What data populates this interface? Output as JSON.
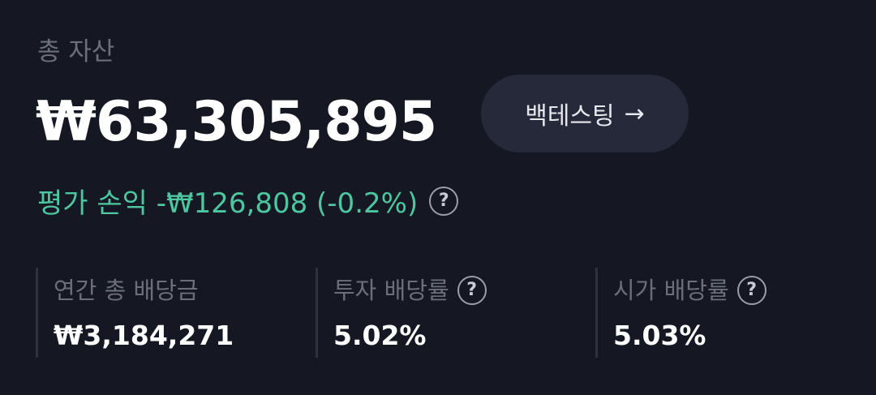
{
  "summary": {
    "total_label": "총 자산",
    "total_value": "₩63,305,895",
    "backtest_label": "백테스팅",
    "backtest_arrow": "→",
    "pnl_text": "평가 손익 -₩126,808 (-0.2%)",
    "help_glyph": "?"
  },
  "stats": [
    {
      "label": "연간 총 배당금",
      "value": "₩3,184,271",
      "has_help": false
    },
    {
      "label": "투자 배당률",
      "value": "5.02%",
      "has_help": true
    },
    {
      "label": "시가 배당률",
      "value": "5.03%",
      "has_help": true
    }
  ],
  "colors": {
    "background": "#151823",
    "button_bg": "#252939",
    "pnl_green": "#4dc7a0",
    "muted_text": "#6b6f7a",
    "divider": "#2e3240"
  },
  "icons": {
    "help": "question-circle-icon",
    "arrow": "arrow-right-icon"
  }
}
